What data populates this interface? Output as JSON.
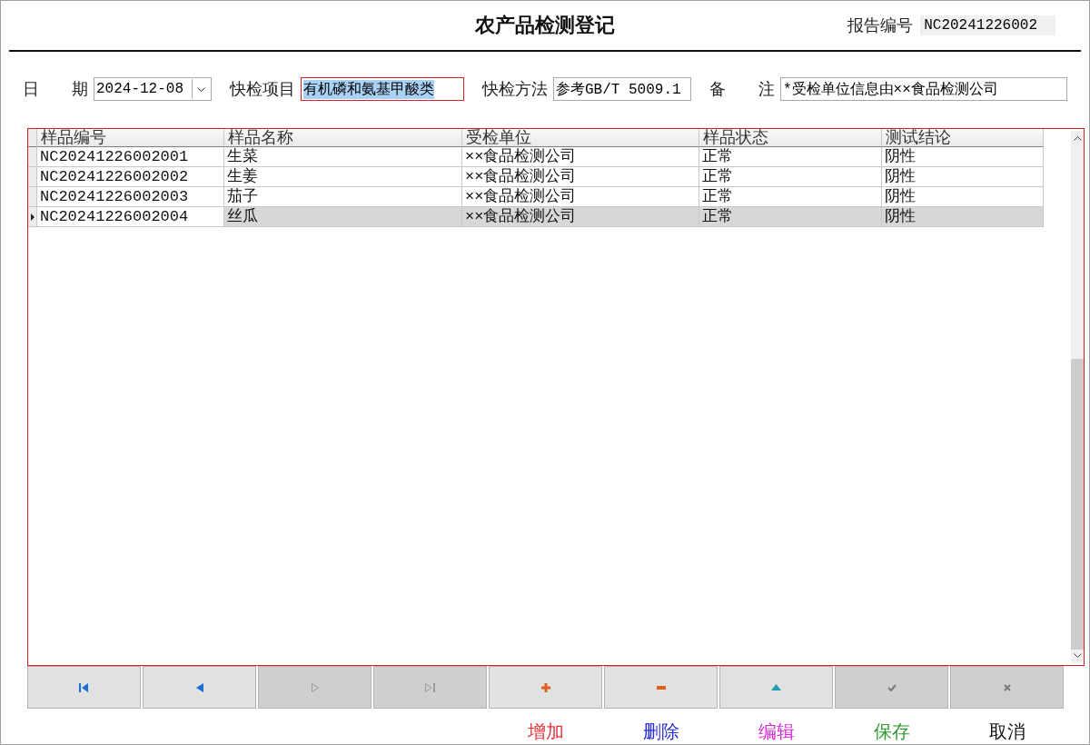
{
  "title": "农产品检测登记",
  "report": {
    "label": "报告编号",
    "value": "NC20241226002"
  },
  "fields": [
    {
      "label": "日期",
      "kind": "date",
      "value": "2024-12-08",
      "highlighted": false
    },
    {
      "label": "快检项目",
      "kind": "text",
      "value": "有机磷和氨基甲酸类",
      "highlighted": true
    },
    {
      "label": "快检方法",
      "kind": "text",
      "value": "参考GB/T 5009.1",
      "highlighted": false
    },
    {
      "label": "备注",
      "kind": "text",
      "value": "*受检单位信息由××食品检测公司",
      "highlighted": false
    }
  ],
  "table": {
    "columns": [
      "样品编号",
      "样品名称",
      "受检单位",
      "样品状态",
      "测试结论"
    ],
    "rows": [
      {
        "cells": [
          "NC20241226002001",
          "生菜",
          "××食品检测公司",
          "正常",
          "阴性"
        ],
        "selected": false
      },
      {
        "cells": [
          "NC20241226002002",
          "生姜",
          "××食品检测公司",
          "正常",
          "阴性"
        ],
        "selected": false
      },
      {
        "cells": [
          "NC20241226002003",
          "茄子",
          "××食品检测公司",
          "正常",
          "阴性"
        ],
        "selected": false
      },
      {
        "cells": [
          "NC20241226002004",
          "丝瓜",
          "××食品检测公司",
          "正常",
          "阴性"
        ],
        "selected": true
      }
    ]
  },
  "navigator": [
    {
      "kind": "first",
      "disabled": false
    },
    {
      "kind": "prev",
      "disabled": false
    },
    {
      "kind": "next",
      "disabled": true
    },
    {
      "kind": "last",
      "disabled": true
    },
    {
      "kind": "add",
      "disabled": false
    },
    {
      "kind": "delete",
      "disabled": false
    },
    {
      "kind": "edit",
      "disabled": false
    },
    {
      "kind": "save",
      "disabled": true
    },
    {
      "kind": "cancel",
      "disabled": true
    }
  ],
  "actions": [
    {
      "label": "增加",
      "color": "#e8303a"
    },
    {
      "label": "删除",
      "color": "#2b2bd8"
    },
    {
      "label": "编辑",
      "color": "#d42ad4"
    },
    {
      "label": "保存",
      "color": "#2e9a2e"
    },
    {
      "label": "取消",
      "color": "#111111"
    }
  ]
}
